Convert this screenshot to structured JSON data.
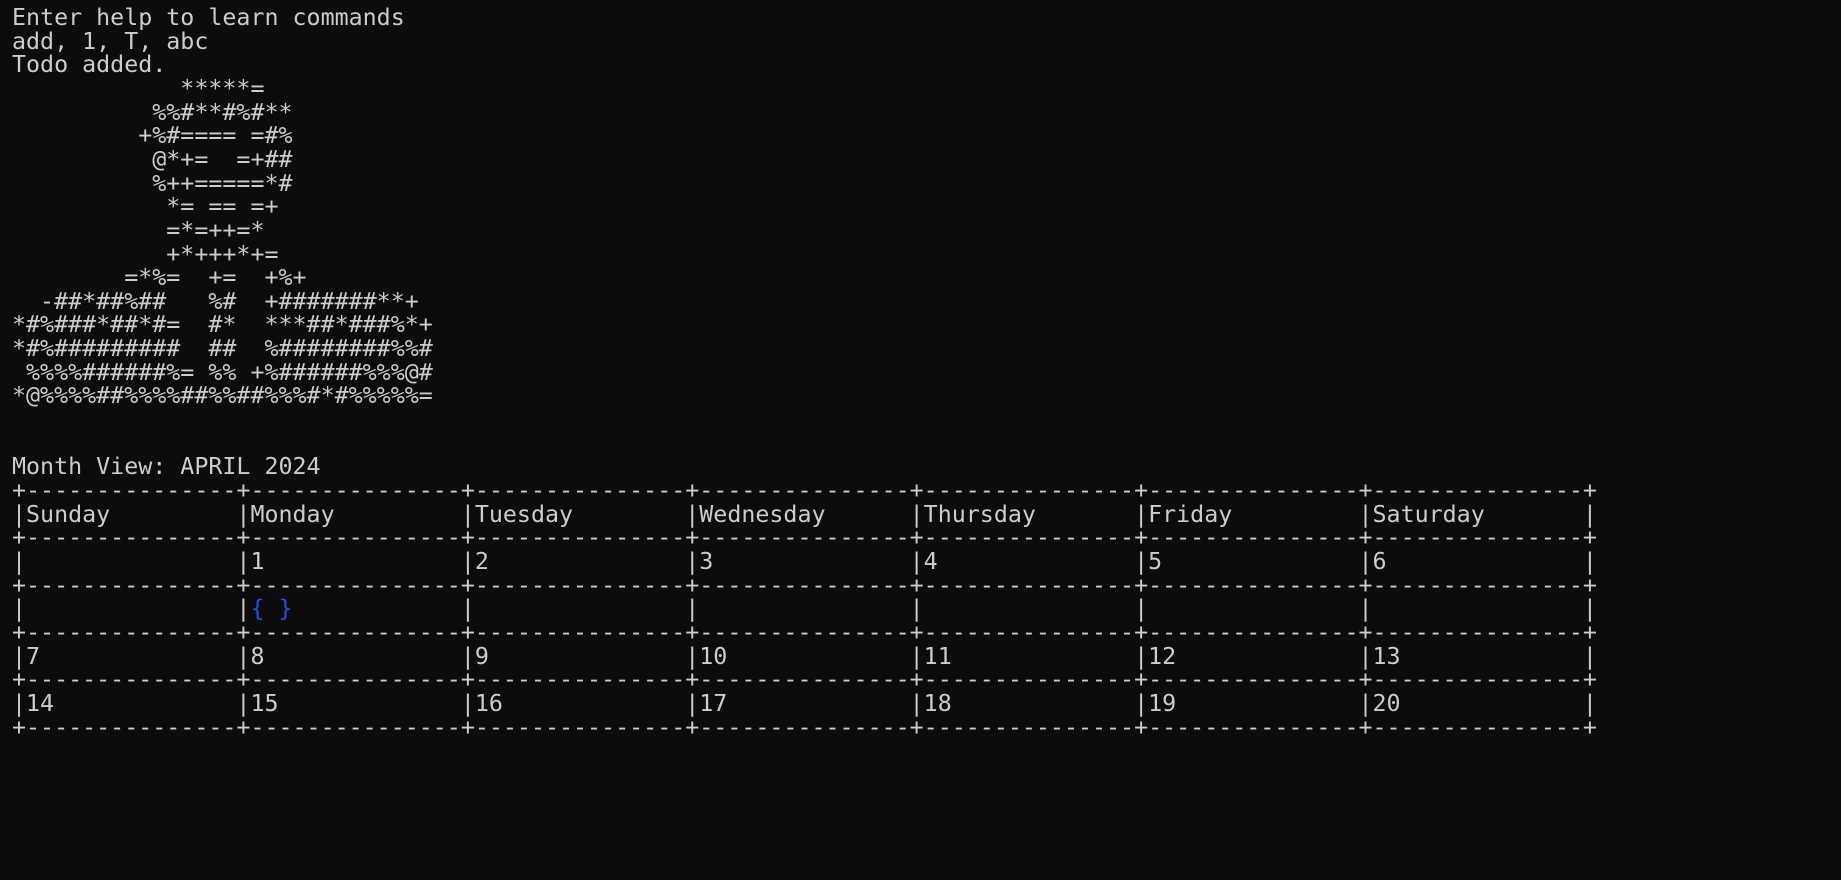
{
  "terminal": {
    "foreground": "#cccccc",
    "background": "#0c0c0c",
    "highlight_color": "#2350e6",
    "lines": [
      "Enter help to learn commands",
      "add, 1, T, abc",
      "Todo added.",
      "            *****=",
      "          %%#**#%#**",
      "         +%#==== =#%",
      "          @*+=  =+##",
      "          %++=====*#",
      "           *= == =+",
      "           =*=++=*",
      "           +*+++*+=",
      "        =*%=  +=  +%+",
      "  -##*##%##   %#  +#######**+",
      "*#%###*##*#=  #*  ***##*###%*+",
      "*#%#########  ##  %########%%#",
      " %%%%######%= %% +%######%%%@#",
      "*@%%%%##%%%%##%%##%%%#*#%%%%%=",
      "",
      "",
      "Month View: APRIL 2024",
      "+---------------+---------------+---------------+---------------+---------------+---------------+---------------+",
      "|Sunday         |Monday         |Tuesday        |Wednesday      |Thursday       |Friday         |Saturday       |",
      "+---------------+---------------+---------------+---------------+---------------+---------------+---------------+",
      "|               |1              |2              |3              |4              |5              |6              |",
      "+---------------+---------------+---------------+---------------+---------------+---------------+---------------+",
      "|               |{ }            |               |               |               |               |               |",
      "+---------------+---------------+---------------+---------------+---------------+---------------+---------------+",
      "|7              |8              |9              |10             |11             |12             |13             |",
      "+---------------+---------------+---------------+---------------+---------------+---------------+---------------+",
      "|14             |15             |16             |17             |18             |19             |20             |",
      "+---------------+---------------+---------------+---------------+---------------+---------------+---------------+"
    ],
    "highlight": {
      "line": 25,
      "text": "{ }"
    }
  }
}
